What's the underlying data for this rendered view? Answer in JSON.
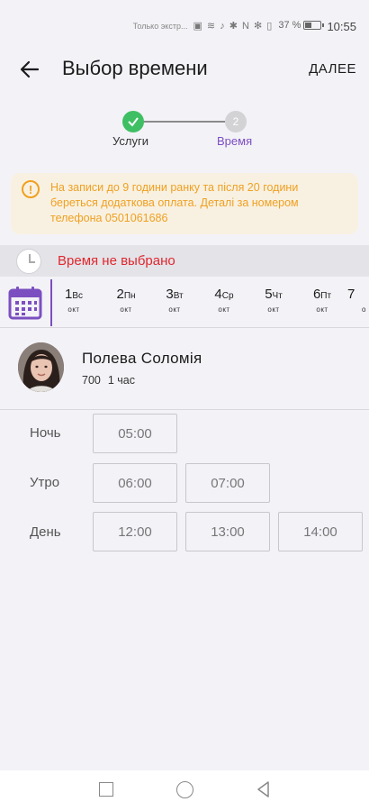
{
  "status_bar": {
    "carrier_text": "Только экстр...",
    "battery": "37 %",
    "time": "10:55"
  },
  "header": {
    "title": "Выбор времени",
    "next_label": "ДАЛЕЕ"
  },
  "stepper": {
    "step1_label": "Услуги",
    "step2_number": "2",
    "step2_label": "Время"
  },
  "warning": {
    "text": "На записи до 9 години ранку та після 20 години береться додаткова оплата. Деталі за номером телефона 0501061686"
  },
  "time_status": {
    "text": "Время не выбрано"
  },
  "dates": [
    {
      "num": "1",
      "day": "Вс",
      "month": "окт"
    },
    {
      "num": "2",
      "day": "Пн",
      "month": "окт"
    },
    {
      "num": "3",
      "day": "Вт",
      "month": "окт"
    },
    {
      "num": "4",
      "day": "Ср",
      "month": "окт"
    },
    {
      "num": "5",
      "day": "Чт",
      "month": "окт"
    },
    {
      "num": "6",
      "day": "Пт",
      "month": "окт"
    },
    {
      "num": "7",
      "day": "",
      "month": "о"
    }
  ],
  "master": {
    "name": "Полева Соломія",
    "price": "700",
    "duration": "1 час"
  },
  "slots": {
    "night_label": "Ночь",
    "morning_label": "Утро",
    "day_label": "День",
    "night": [
      "05:00"
    ],
    "morning": [
      "06:00",
      "07:00"
    ],
    "day": [
      "12:00",
      "13:00",
      "14:00"
    ]
  },
  "colors": {
    "accent": "#7b4fc0",
    "success": "#3fbf63",
    "warning": "#f0a020",
    "error": "#e0282e"
  }
}
